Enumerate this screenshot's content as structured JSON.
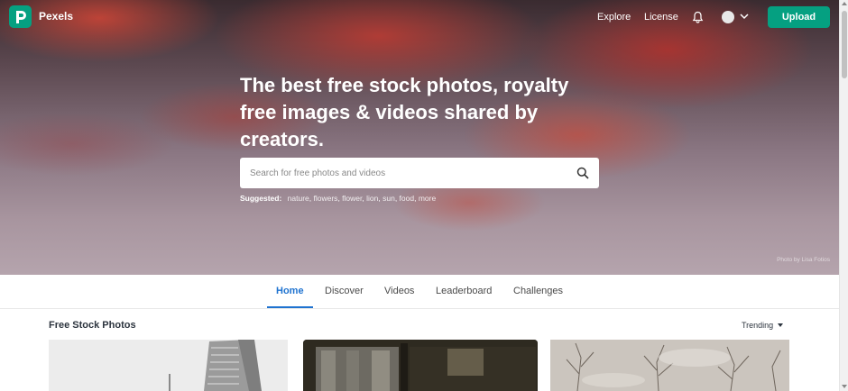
{
  "header": {
    "logo_letter": "P",
    "brand": "Pexels",
    "nav": {
      "explore": "Explore",
      "license": "License"
    },
    "upload_label": "Upload",
    "accent": "#05a081"
  },
  "hero": {
    "headline": "The best free stock photos, royalty free images & videos shared by creators.",
    "search": {
      "placeholder": "Search for free photos and videos"
    },
    "suggested_label": "Suggested:",
    "suggested": [
      "nature",
      "flowers",
      "flower",
      "lion",
      "sun",
      "food",
      "more"
    ],
    "credit": "Photo by Lisa Fotios"
  },
  "tabs": {
    "items": [
      "Home",
      "Discover",
      "Videos",
      "Leaderboard",
      "Challenges"
    ],
    "active": "Home",
    "active_color": "#1f73d0"
  },
  "content": {
    "section_title": "Free Stock Photos",
    "sort_label": "Trending"
  }
}
